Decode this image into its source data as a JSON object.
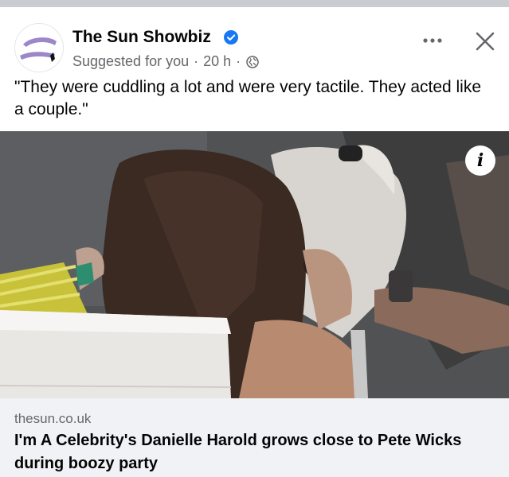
{
  "post": {
    "page_name": "The Sun Showbiz",
    "verified": true,
    "suggested_label": "Suggested for you",
    "separator": "·",
    "time_ago": "20 h",
    "audience_icon": "globe-icon",
    "text": "\"They were cuddling a lot and were very tactile. They acted like a couple.\""
  },
  "link_preview": {
    "domain": "thesun.co.uk",
    "headline": "I'm A Celebrity's Danielle Harold grows close to Pete Wicks during boozy party"
  },
  "photo": {
    "info_label": "i"
  },
  "icons": {
    "more": "more-options-icon",
    "close": "close-icon",
    "verified": "verified-badge-icon"
  },
  "colors": {
    "verified_blue": "#1877f2",
    "secondary_text": "#65676b",
    "preview_bg": "#f0f2f5",
    "logo_purple": "#9b87c9"
  }
}
